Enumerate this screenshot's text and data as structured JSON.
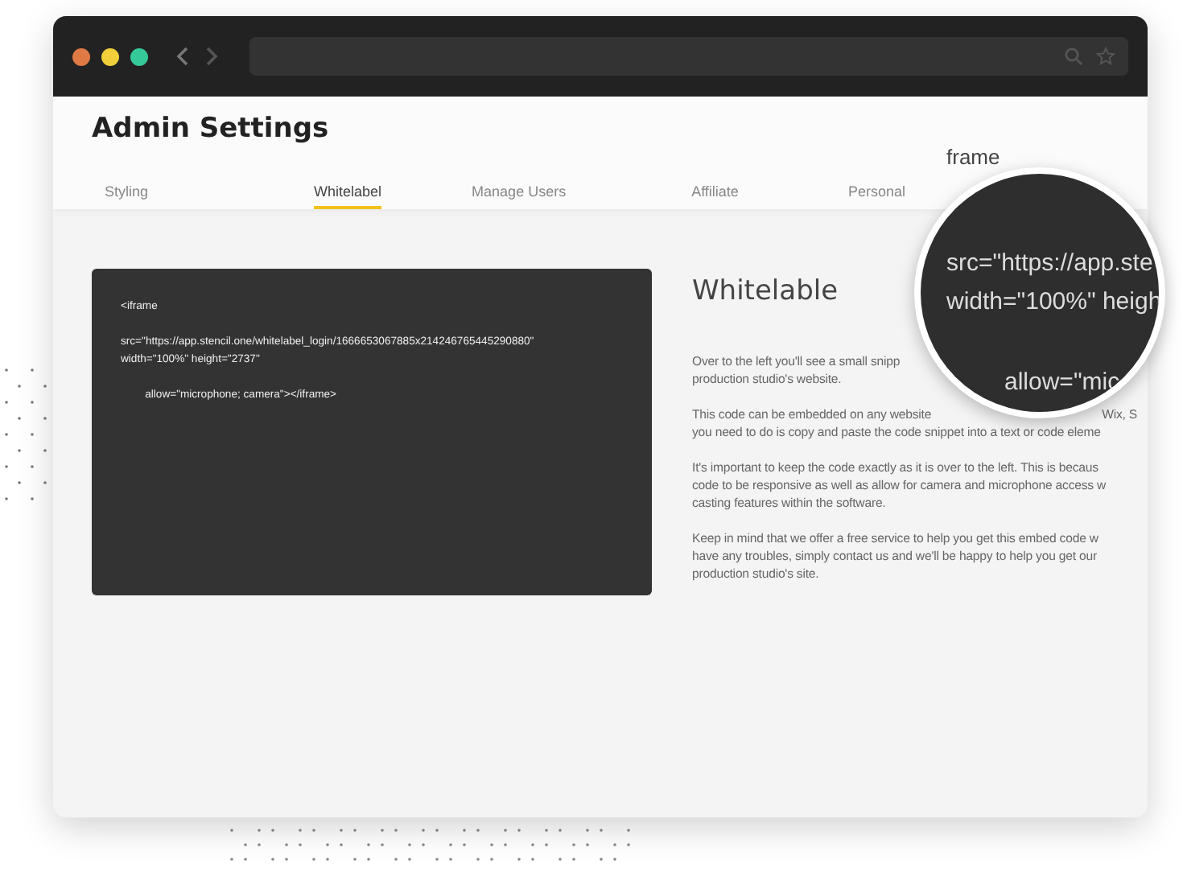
{
  "browser": {
    "traffic_lights": [
      {
        "color": "#e07a45"
      },
      {
        "color": "#f0cf3a"
      },
      {
        "color": "#35c99a"
      }
    ]
  },
  "header": {
    "title": "Admin Settings"
  },
  "tabs": [
    {
      "label": "Styling",
      "selected": false
    },
    {
      "label": "Whitelabel",
      "selected": true
    },
    {
      "label": "Manage Users",
      "selected": false
    },
    {
      "label": "Affiliate",
      "selected": false
    },
    {
      "label": "Personal",
      "selected": false
    }
  ],
  "code_block": {
    "blocks": [
      [
        "<iframe"
      ],
      [
        "src=\"https://app.stencil.one/whitelabel_login/1666653067885x214246765445290880\"",
        "width=\"100%\" height=\"2737\""
      ],
      [
        "        allow=\"microphone; camera\"></iframe>"
      ]
    ]
  },
  "info": {
    "title": "Whitelable",
    "paragraphs": [
      [
        [
          "Over to the left you'll see a small snipp"
        ],
        [
          "production studio's website."
        ]
      ],
      [
        [
          "This code can be embedded on any website",
          "Wix, S"
        ],
        [
          "you need to do is copy and paste the code snippet into a text or code eleme"
        ]
      ],
      [
        [
          "It's important to keep the code exactly as it is over to the left. This is becaus"
        ],
        [
          "code to be responsive as well as allow for camera and microphone access w"
        ],
        [
          "casting features within the software."
        ]
      ],
      [
        [
          "Keep in mind that we offer a free service to help you get this embed code w"
        ],
        [
          "have any troubles, simply contact us and we'll be happy to help you get our"
        ],
        [
          "production studio's site."
        ]
      ]
    ]
  },
  "magnifier": {
    "above": "frame",
    "blocks": [
      [
        "src=\"https://app.ste",
        "width=\"100%\" heigh"
      ],
      [
        "allow=\"mic"
      ]
    ]
  }
}
